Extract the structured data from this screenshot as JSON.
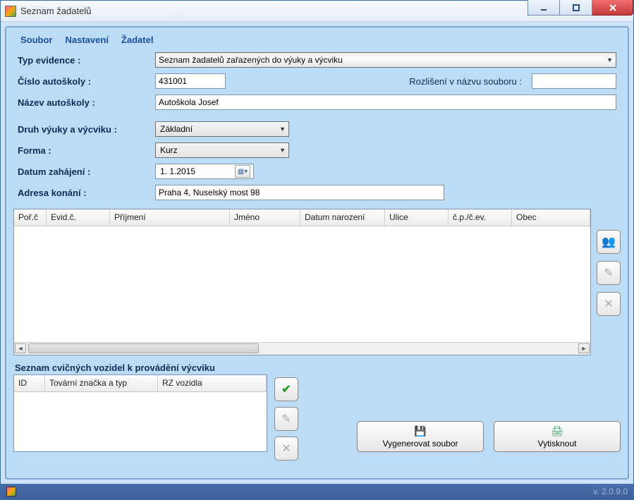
{
  "window": {
    "title": "Seznam žadatelů"
  },
  "menu": {
    "file": "Soubor",
    "settings": "Nastavení",
    "applicant": "Žadatel"
  },
  "form": {
    "evidence_label": "Typ evidence :",
    "evidence_value": "Seznam žadatelů zařazených do výuky a výcviku",
    "schoolnum_label": "Číslo autoškoly :",
    "schoolnum_value": "431001",
    "filediff_label": "Rozlišení v názvu souboru :",
    "filediff_value": "",
    "schoolname_label": "Název autoškoly :",
    "schoolname_value": "Autoškola Josef",
    "traintype_label": "Druh výuky a výcviku :",
    "traintype_value": "Základní",
    "form_label": "Forma :",
    "form_value": "Kurz",
    "startdate_label": "Datum zahájení :",
    "startdate_value": "1.  1.2015",
    "address_label": "Adresa konání :",
    "address_value": "Praha 4, Nuselský most 98"
  },
  "applicants_table": {
    "columns": [
      "Poř.č",
      "Evid.č.",
      "Příjmení",
      "Jméno",
      "Datum narození",
      "Ulice",
      "č.p./č.ev.",
      "Obec"
    ]
  },
  "vehicles": {
    "title": "Seznam cvičných vozidel k provádění výcviku",
    "columns": [
      "ID",
      "Tovární značka a typ",
      "RZ vozidla"
    ]
  },
  "buttons": {
    "generate": "Vygenerovat soubor",
    "print": "Vytisknout"
  },
  "status": {
    "version": "v. 2.0.9.0"
  }
}
